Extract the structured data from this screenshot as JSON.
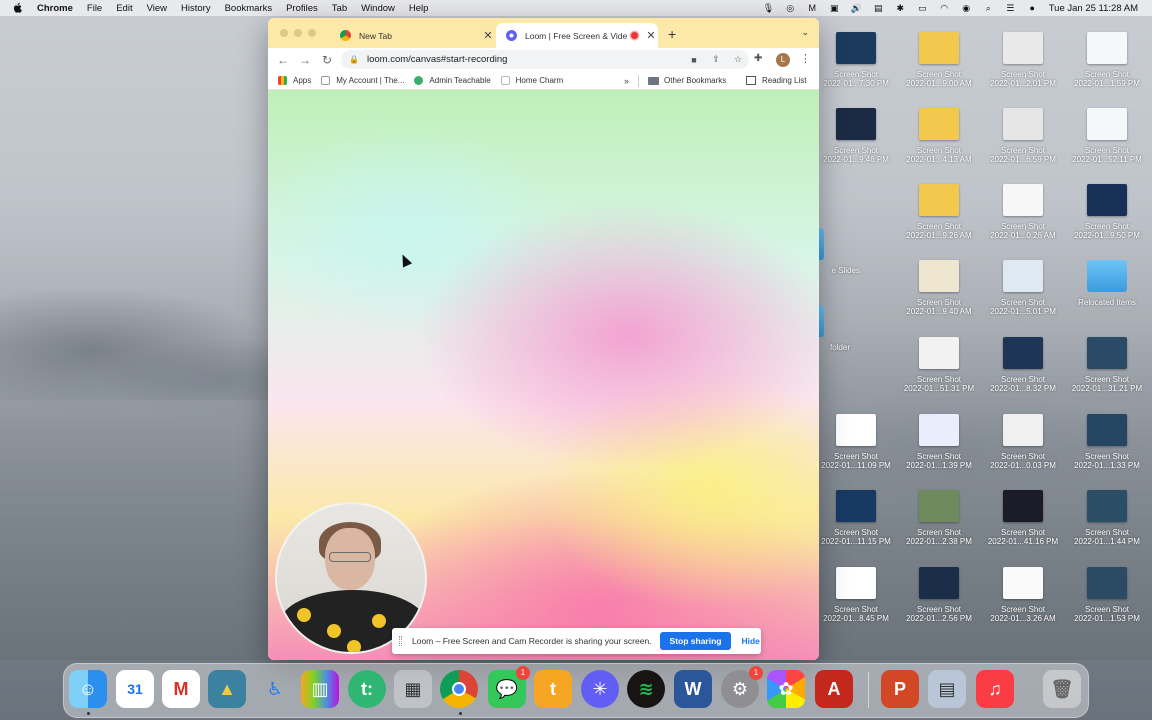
{
  "menubar": {
    "app": "Chrome",
    "items": [
      "File",
      "Edit",
      "View",
      "History",
      "Bookmarks",
      "Profiles",
      "Tab",
      "Window",
      "Help"
    ],
    "clock": "Tue Jan 25  11:28 AM"
  },
  "browser": {
    "tabs": [
      {
        "title": "New Tab",
        "active": false
      },
      {
        "title": "Loom | Free Screen & Vide",
        "active": true
      }
    ],
    "url": "loom.com/canvas#start-recording",
    "bookmarks": {
      "apps": "Apps",
      "items": [
        "My Account | The...",
        "Admin Teachable",
        "Home Charm"
      ],
      "more": "»",
      "other": "Other Bookmarks",
      "reading": "Reading List"
    },
    "avatar_letter": "L"
  },
  "share_bar": {
    "message": "Loom – Free Screen and Cam Recorder is sharing your screen.",
    "stop": "Stop sharing",
    "hide": "Hide"
  },
  "desktop": {
    "icons": [
      {
        "l1": "Screen Shot",
        "l2": "2022-01...7.30 PM",
        "color": "#1b3a5c"
      },
      {
        "l1": "Screen Shot",
        "l2": "2022-01...9.00 AM",
        "color": "#f2c94c"
      },
      {
        "l1": "Screen Shot",
        "l2": "2022-01...2.01 PM",
        "color": "#e9e9e9"
      },
      {
        "l1": "Screen Shot",
        "l2": "2022-01...1.59 PM",
        "color": "#f5f8fa"
      },
      {
        "l1": "Screen Shot",
        "l2": "2022-01...9.46 PM",
        "color": "#1c2a44"
      },
      {
        "l1": "Screen Shot",
        "l2": "2022-01...4.13 AM",
        "color": "#f2c94c"
      },
      {
        "l1": "Screen Shot",
        "l2": "2022-01...6.59 PM",
        "color": "#e6e6e6"
      },
      {
        "l1": "Screen Shot",
        "l2": "2022-01...52.11 PM",
        "color": "#f4f8fb"
      },
      {
        "l1": "Screen Shot",
        "l2": "2022-01...9.26 AM",
        "color": "#f2c94c"
      },
      {
        "l1": "Screen Shot",
        "l2": "2022-01...0.26 AM",
        "color": "#f7f7f7"
      },
      {
        "l1": "Screen Shot",
        "l2": "2022-01...9.50 PM",
        "color": "#173055"
      },
      {
        "l1": "Screen Shot",
        "l2": "2022-01...9.40 AM",
        "color": "#efe6cf"
      },
      {
        "l1": "Screen Shot",
        "l2": "2022-01...5.01 PM",
        "color": "#dfe9f2"
      },
      {
        "l1": "Relocated Items",
        "l2": "",
        "color": "folder"
      },
      {
        "l1": "Screen Shot",
        "l2": "2022-01...51.31 PM",
        "color": "#f2f2f2"
      },
      {
        "l1": "Screen Shot",
        "l2": "2022-01...8.32 PM",
        "color": "#1e3557"
      },
      {
        "l1": "Screen Shot",
        "l2": "2022-01...31.21 PM",
        "color": "#2b4a66"
      },
      {
        "l1": "Screen Shot",
        "l2": "2022-01...11.09 PM",
        "color": "#ffffff"
      },
      {
        "l1": "Screen Shot",
        "l2": "2022-01...1.39 PM",
        "color": "#e9eefc"
      },
      {
        "l1": "Screen Shot",
        "l2": "2022-01...0.03 PM",
        "color": "#f0f0f0"
      },
      {
        "l1": "Screen Shot",
        "l2": "2022-01...1.33 PM",
        "color": "#244663"
      },
      {
        "l1": "Screen Shot",
        "l2": "2022-01...11.15 PM",
        "color": "#173a63"
      },
      {
        "l1": "Screen Shot",
        "l2": "2022-01...2.38 PM",
        "color": "#6f8a5c"
      },
      {
        "l1": "Screen Shot",
        "l2": "2022-01...41.16 PM",
        "color": "#1b1b2a"
      },
      {
        "l1": "Screen Shot",
        "l2": "2022-01...1.44 PM",
        "color": "#2b4e66"
      },
      {
        "l1": "Screen Shot",
        "l2": "2022-01...8.45 PM",
        "color": "#ffffff"
      },
      {
        "l1": "Screen Shot",
        "l2": "2022-01...2.56 PM",
        "color": "#1a2e4a"
      },
      {
        "l1": "Screen Shot",
        "l2": "2022-01...3.26 AM",
        "color": "#fafafa"
      },
      {
        "l1": "Screen Shot",
        "l2": "2022-01...1.53 PM",
        "color": "#2a4b63"
      }
    ],
    "partial_labels": [
      "e Slides",
      "folder"
    ]
  },
  "dock": {
    "calendar_day": "31",
    "messages_badge": "1",
    "settings_badge": "1",
    "word_letter": "W",
    "teachable_letter": "t:"
  }
}
